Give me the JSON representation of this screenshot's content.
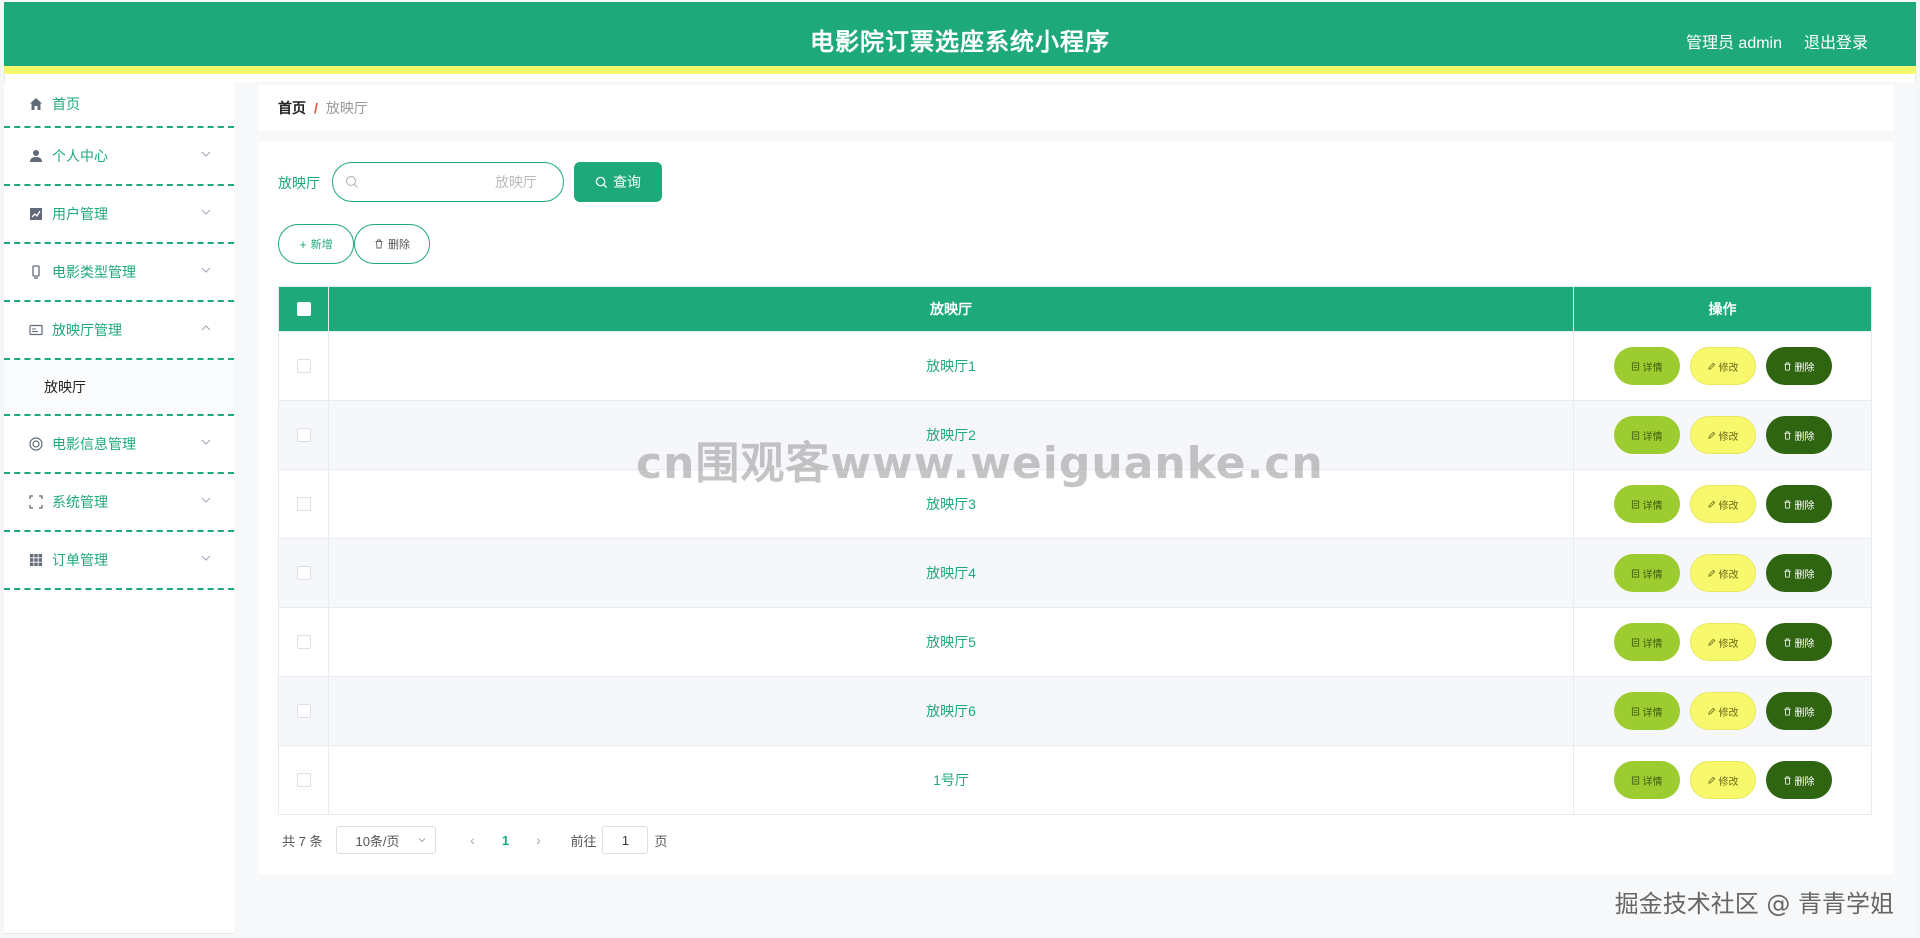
{
  "header": {
    "title": "电影院订票选座系统小程序",
    "user": "管理员 admin",
    "logout": "退出登录"
  },
  "sidebar": {
    "items": [
      {
        "label": "首页",
        "icon": "home-icon"
      },
      {
        "label": "个人中心",
        "icon": "user-icon"
      },
      {
        "label": "用户管理",
        "icon": "chart-icon"
      },
      {
        "label": "电影类型管理",
        "icon": "film-icon"
      },
      {
        "label": "放映厅管理",
        "icon": "card-icon",
        "expanded": true
      },
      {
        "label": "电影信息管理",
        "icon": "reel-icon"
      },
      {
        "label": "系统管理",
        "icon": "frame-icon"
      },
      {
        "label": "订单管理",
        "icon": "grid-icon"
      }
    ],
    "submenu": {
      "label": "放映厅"
    }
  },
  "breadcrumb": {
    "home": "首页",
    "separator": "/",
    "current": "放映厅"
  },
  "search": {
    "label": "放映厅",
    "placeholder": "放映厅",
    "value": "",
    "button": "查询"
  },
  "actions": {
    "add": "新增",
    "delete": "删除"
  },
  "table": {
    "headers": [
      "放映厅",
      "操作"
    ],
    "rows": [
      {
        "name": "放映厅1"
      },
      {
        "name": "放映厅2"
      },
      {
        "name": "放映厅3"
      },
      {
        "name": "放映厅4"
      },
      {
        "name": "放映厅5"
      },
      {
        "name": "放映厅6"
      },
      {
        "name": "1号厅"
      }
    ],
    "ops": {
      "detail": "详情",
      "edit": "修改",
      "delete": "删除"
    }
  },
  "pagination": {
    "total": "共 7 条",
    "page_size": "10条/页",
    "current_page": "1",
    "goto_prefix": "前往",
    "goto_value": "1",
    "goto_suffix": "页"
  },
  "watermarks": {
    "center": "cn围观客www.weiguanke.cn",
    "corner": "掘金技术社区 @ 青青学姐"
  },
  "colors": {
    "primary": "#1ea97a",
    "header_accent": "#f4f86a",
    "detail_btn": "#9ccc2f",
    "edit_btn": "#f7f86c",
    "delete_btn": "#2f6411"
  }
}
